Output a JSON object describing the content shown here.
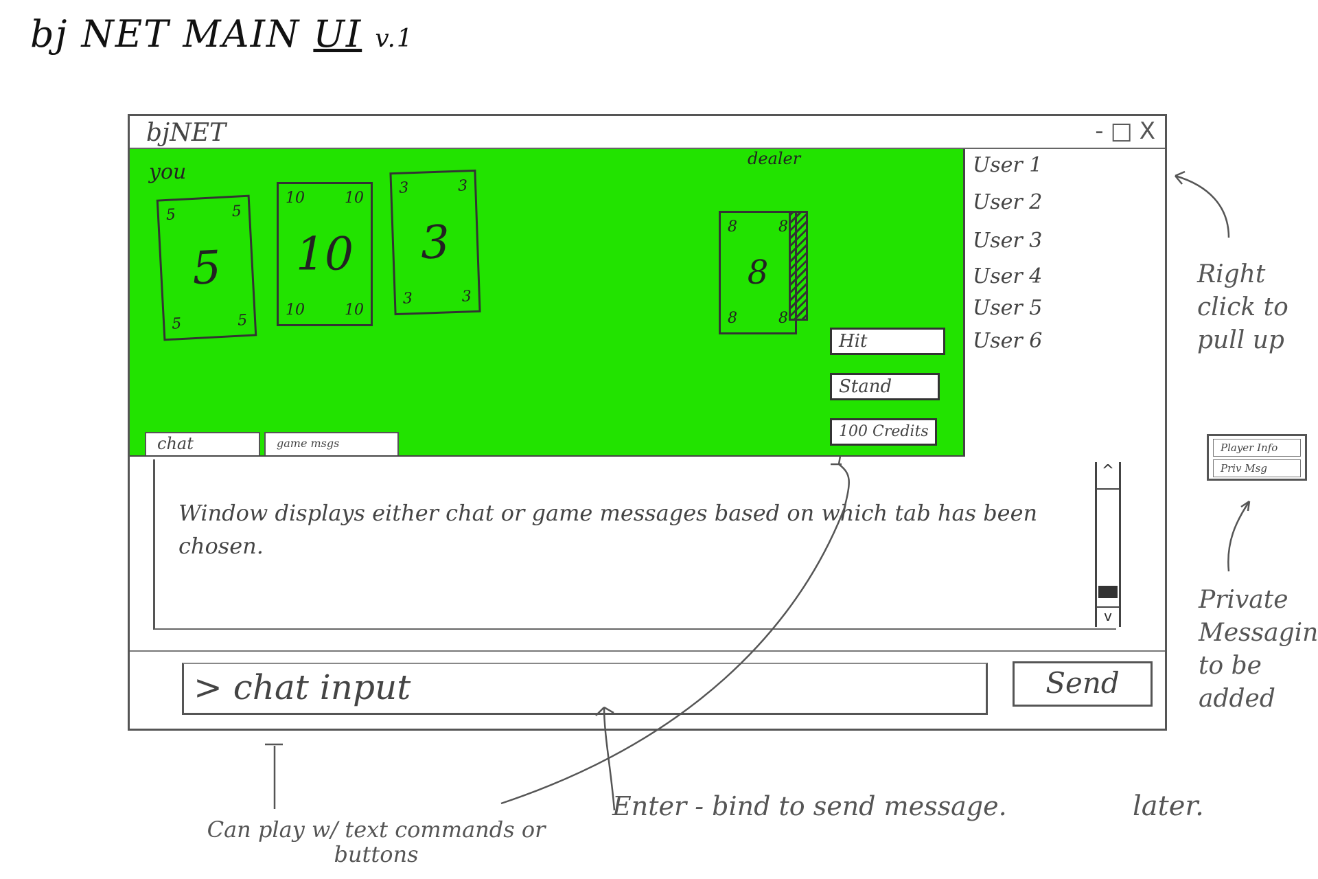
{
  "sketch": {
    "title_prefix": "bj NET MAIN",
    "title_ui": "UI",
    "title_version": "v.1"
  },
  "window": {
    "title": "bjNET",
    "controls": {
      "minimize": "-",
      "maximize": "□",
      "close": "X"
    }
  },
  "table": {
    "you_label": "you",
    "dealer_label": "dealer",
    "player_cards": [
      {
        "corner": "5",
        "center": "5"
      },
      {
        "corner": "10",
        "center": "10"
      },
      {
        "corner": "3",
        "center": "3"
      }
    ],
    "dealer_card": {
      "corner": "8",
      "center": "8"
    },
    "buttons": {
      "hit": "Hit",
      "stand": "Stand",
      "credits": "100 Credits"
    },
    "tabs": {
      "chat": "chat",
      "game": "game msgs"
    }
  },
  "users": [
    "User 1",
    "User 2",
    "User 3",
    "User 4",
    "User 5",
    "User 6"
  ],
  "messages": {
    "text": "Window displays either chat or game messages based on which tab has been chosen."
  },
  "chat": {
    "input": "> chat input",
    "send": "Send"
  },
  "context_menu": {
    "items": [
      "Player Info",
      "Priv Msg"
    ]
  },
  "annotations": {
    "right_click": "Right click to pull up",
    "private_messaging": "Private Messaging to be added",
    "commands": "Can play w/ text commands or buttons",
    "enter": "Enter - bind to send message.",
    "later": "later."
  }
}
